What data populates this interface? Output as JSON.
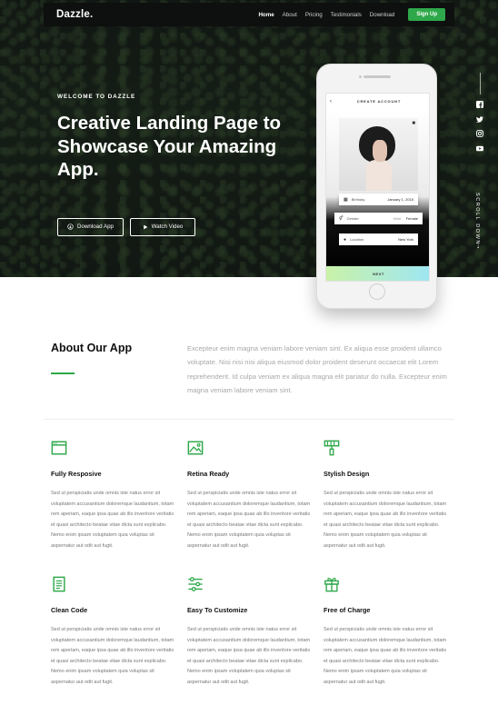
{
  "nav": {
    "logo": "Dazzle.",
    "links": [
      "Home",
      "About",
      "Pricing",
      "Testimonials",
      "Download"
    ],
    "signup": "Sign Up"
  },
  "hero": {
    "welcome": "WELCOME TO DAZZLE",
    "headline": "Creative Landing Page to Showcase Your Amazing App.",
    "download_btn": "Download App",
    "watch_btn": "Watch Video",
    "scroll_text": "SCROLL DOWN",
    "social_icons": [
      "facebook-icon",
      "twitter-icon",
      "instagram-icon",
      "youtube-icon"
    ]
  },
  "phone": {
    "screen_title": "CREATE ACCOUNT",
    "birthday_label": "Birthday",
    "birthday_value": "January 1, 2015",
    "gender_label": "Gender",
    "gender_option1": "Male",
    "gender_option2": "Female",
    "location_label": "Location",
    "location_value": "New York",
    "next": "NEXT"
  },
  "about": {
    "title": "About Our App",
    "text": "Excepteur enim magna veniam labore veniam sint. Ex aliqua esse proident ullamco voluptate. Nisi nisi nisi aliqua eiusmod dolor proident deserunt occaecat elit Lorem reprehenderit. Id culpa veniam ex aliqua magna elit pariatur do nulla. Excepteur enim magna veniam labore veniam sint."
  },
  "features": [
    {
      "title": "Fully Resposive",
      "icon": "browser-window-icon",
      "text": "Sed ut perspiciatis unde omnis iste natus error sit voluptatem accusantium doloremque laudantium, totam rem aperiam, eaque ipsa quae ab illo inventore veritatis et quasi architecto beatae vitae dicta sunt explicabo. Nemo enim ipsam voluptatem quia voluptas sit aspernatur aut odit aut fugit."
    },
    {
      "title": "Retina Ready",
      "icon": "image-icon",
      "text": "Sed ut perspiciatis unde omnis iste natus error sit voluptatem accusantium doloremque laudantium, totam rem aperiam, eaque ipsa quae ab illo inventore veritatis et quasi architecto beatae vitae dicta sunt explicabo. Nemo enim ipsam voluptatem quia voluptas sit aspernatur aut odit aut fugit."
    },
    {
      "title": "Stylish Design",
      "icon": "paint-roller-icon",
      "text": "Sed ut perspiciatis unde omnis iste natus error sit voluptatem accusantium doloremque laudantium, totam rem aperiam, eaque ipsa quae ab illo inventore veritatis et quasi architecto beatae vitae dicta sunt explicabo. Nemo enim ipsam voluptatem quia voluptas sit aspernatur aut odit aut fugit."
    },
    {
      "title": "Clean Code",
      "icon": "document-icon",
      "text": "Sed ut perspiciatis unde omnis iste natus error sit voluptatem accusantium doloremque laudantium, totam rem aperiam, eaque ipsa quae ab illo inventore veritatis et quasi architecto beatae vitae dicta sunt explicabo. Nemo enim ipsam voluptatem quia voluptas sit aspernatur aut odit aut fugit."
    },
    {
      "title": "Easy To Customize",
      "icon": "sliders-icon",
      "text": "Sed ut perspiciatis unde omnis iste natus error sit voluptatem accusantium doloremque laudantium, totam rem aperiam, eaque ipsa quae ab illo inventore veritatis et quasi architecto beatae vitae dicta sunt explicabo. Nemo enim ipsam voluptatem quia voluptas sit aspernatur aut odit aut fugit."
    },
    {
      "title": "Free of Charge",
      "icon": "gift-icon",
      "text": "Sed ut perspiciatis unde omnis iste natus error sit voluptatem accusantium doloremque laudantium, totam rem aperiam, eaque ipsa quae ab illo inventore veritatis et quasi architecto beatae vitae dicta sunt explicabo. Nemo enim ipsam voluptatem quia voluptas sit aspernatur aut odit aut fugit."
    }
  ],
  "colors": {
    "accent": "#2ea84a",
    "nav_bg": "#0e0f0f"
  }
}
